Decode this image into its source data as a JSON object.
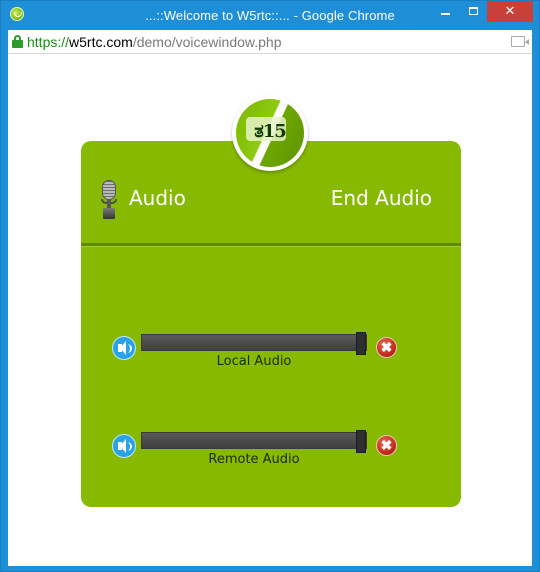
{
  "window": {
    "title": "...::Welcome to W5rtc::... - Google Chrome",
    "minimize_label": "–",
    "close_label": "✕"
  },
  "address_bar": {
    "scheme": "https://",
    "host": "w5rtc.com",
    "path": "/demo/voicewindow.php"
  },
  "panel": {
    "logo_text": "ತ15",
    "audio_label": "Audio",
    "end_audio_label": "End Audio",
    "tracks": [
      {
        "label": "Local Audio",
        "level": 1.0
      },
      {
        "label": "Remote Audio",
        "level": 1.0
      }
    ],
    "close_glyph": "✖"
  },
  "colors": {
    "panel_green": "#87b900",
    "titlebar_blue": "#1e8fd6",
    "close_red": "#c7403a",
    "speaker_blue": "#2aa3e6"
  },
  "icons": [
    "app-logo-icon",
    "lock-icon",
    "camera-icon",
    "microphone-icon",
    "speaker-icon",
    "close-icon"
  ]
}
